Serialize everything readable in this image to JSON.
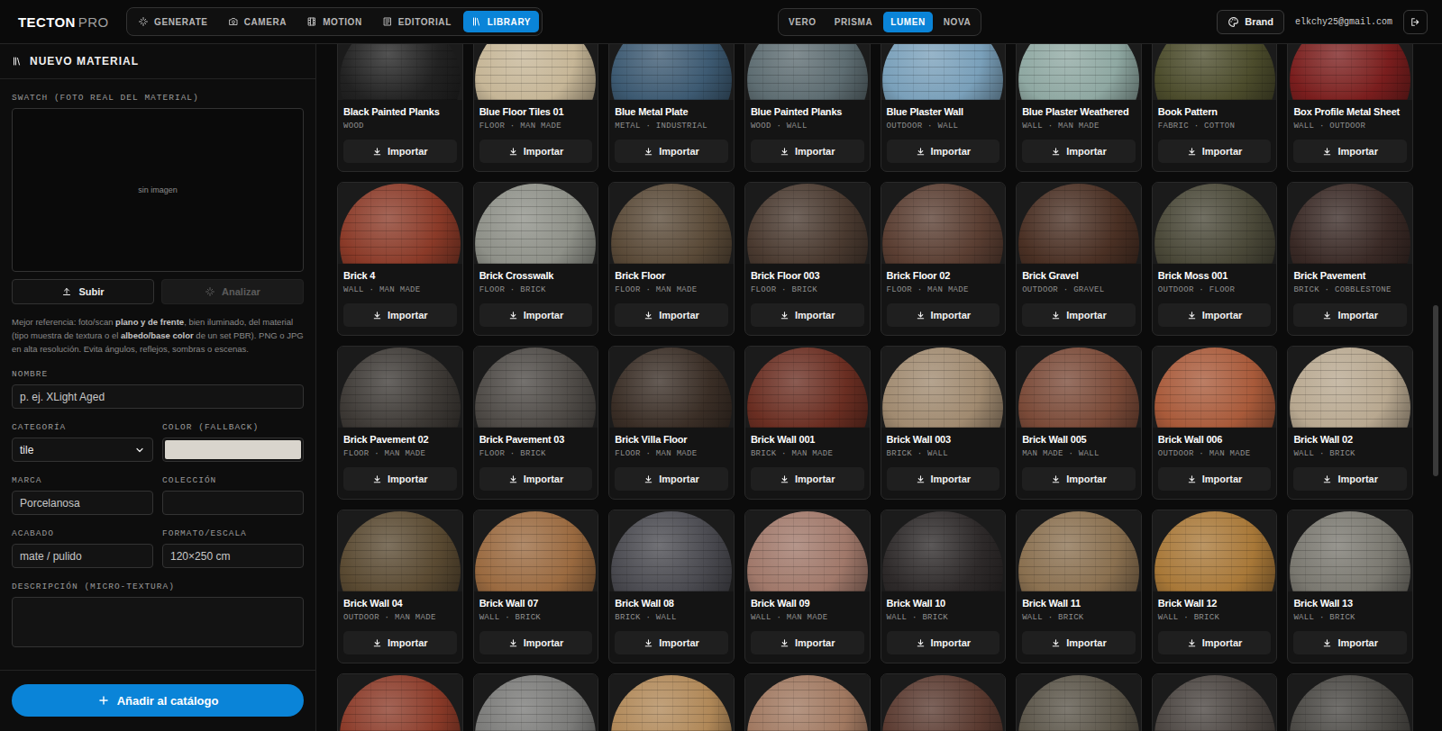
{
  "header": {
    "logo": "TECTON",
    "logo_suffix": "PRO",
    "nav": [
      {
        "label": "GENERATE",
        "selected": false
      },
      {
        "label": "CAMERA",
        "selected": false
      },
      {
        "label": "MOTION",
        "selected": false
      },
      {
        "label": "EDITORIAL",
        "selected": false
      },
      {
        "label": "LIBRARY",
        "selected": true
      }
    ],
    "modes": [
      {
        "label": "VERO",
        "selected": false
      },
      {
        "label": "PRISMA",
        "selected": false
      },
      {
        "label": "LUMEN",
        "selected": true
      },
      {
        "label": "NOVA",
        "selected": false
      }
    ],
    "brand_button": "Brand",
    "email": "elkchy25@gmail.com"
  },
  "sidebar": {
    "title": "NUEVO MATERIAL",
    "swatch_label": "SWATCH (FOTO REAL DEL MATERIAL)",
    "swatch_empty": "sin imagen",
    "upload_button": {
      "label": "Subir",
      "disabled": false
    },
    "analyze_button": {
      "label": "Analizar",
      "disabled": true
    },
    "hint": [
      {
        "text": "Mejor referencia: foto/scan ",
        "bold": false
      },
      {
        "text": "plano y de frente",
        "bold": true
      },
      {
        "text": ", bien iluminado, del material (tipo muestra de textura o el ",
        "bold": false
      },
      {
        "text": "albedo/base color",
        "bold": true
      },
      {
        "text": " de un set PBR). PNG o JPG en alta resolución. Evita ángulos, reflejos, sombras o escenas.",
        "bold": false
      }
    ],
    "field_rows": [
      [
        {
          "label": "NOMBRE",
          "kind": "text",
          "placeholder": "p. ej. XLight Aged"
        }
      ],
      [
        {
          "label": "CATEGORÍA",
          "kind": "select",
          "value": "tile"
        },
        {
          "label": "COLOR (FALLBACK)",
          "kind": "color",
          "value": "#d9d5cd"
        }
      ],
      [
        {
          "label": "MARCA",
          "kind": "text",
          "placeholder": "Porcelanosa"
        },
        {
          "label": "COLECCIÓN",
          "kind": "text",
          "placeholder": ""
        }
      ],
      [
        {
          "label": "ACABADO",
          "kind": "text",
          "placeholder": "mate / pulido"
        },
        {
          "label": "FORMATO/ESCALA",
          "kind": "text",
          "placeholder": "120×250 cm"
        }
      ],
      [
        {
          "label": "DESCRIPCIÓN (MICRO-TEXTURA)",
          "kind": "textarea",
          "placeholder": ""
        }
      ]
    ],
    "submit_button": "Añadir al catálogo"
  },
  "materials": [
    {
      "name": "Black Painted Planks",
      "tags": "WOOD",
      "button": "Importar",
      "color": "#222222"
    },
    {
      "name": "Blue Floor Tiles 01",
      "tags": "FLOOR · MAN MADE",
      "button": "Importar",
      "color": "#c6b697"
    },
    {
      "name": "Blue Metal Plate",
      "tags": "METAL · INDUSTRIAL",
      "button": "Importar",
      "color": "#3d5a72"
    },
    {
      "name": "Blue Painted Planks",
      "tags": "WOOD · WALL",
      "button": "Importar",
      "color": "#5e6d72"
    },
    {
      "name": "Blue Plaster Wall",
      "tags": "OUTDOOR · WALL",
      "button": "Importar",
      "color": "#7aa0ba"
    },
    {
      "name": "Blue Plaster Weathered",
      "tags": "WALL · MAN MADE",
      "button": "Importar",
      "color": "#8fa8a2"
    },
    {
      "name": "Book Pattern",
      "tags": "FABRIC · COTTON",
      "button": "Importar",
      "color": "#4c4c2c"
    },
    {
      "name": "Box Profile Metal Sheet",
      "tags": "WALL · OUTDOOR",
      "button": "Importar",
      "color": "#7a1e1e"
    },
    {
      "name": "Brick 4",
      "tags": "WALL · MAN MADE",
      "button": "Importar",
      "color": "#8a3a28"
    },
    {
      "name": "Brick Crosswalk",
      "tags": "FLOOR · BRICK",
      "button": "Importar",
      "color": "#8e9088"
    },
    {
      "name": "Brick Floor",
      "tags": "FLOOR · MAN MADE",
      "button": "Importar",
      "color": "#5a4a38"
    },
    {
      "name": "Brick Floor 003",
      "tags": "FLOOR · BRICK",
      "button": "Importar",
      "color": "#4a3a30"
    },
    {
      "name": "Brick Floor 02",
      "tags": "FLOOR · MAN MADE",
      "button": "Importar",
      "color": "#5a3e32"
    },
    {
      "name": "Brick Gravel",
      "tags": "OUTDOOR · GRAVEL",
      "button": "Importar",
      "color": "#4a3024"
    },
    {
      "name": "Brick Moss 001",
      "tags": "OUTDOOR · FLOOR",
      "button": "Importar",
      "color": "#4a4838"
    },
    {
      "name": "Brick Pavement",
      "tags": "BRICK · COBBLESTONE",
      "button": "Importar",
      "color": "#3a2a26"
    },
    {
      "name": "Brick Pavement 02",
      "tags": "FLOOR · MAN MADE",
      "button": "Importar",
      "color": "#3e3a36"
    },
    {
      "name": "Brick Pavement 03",
      "tags": "FLOOR · BRICK",
      "button": "Importar",
      "color": "#4e4a46"
    },
    {
      "name": "Brick Villa Floor",
      "tags": "FLOOR · MAN MADE",
      "button": "Importar",
      "color": "#3a2e26"
    },
    {
      "name": "Brick Wall 001",
      "tags": "BRICK · MAN MADE",
      "button": "Importar",
      "color": "#6a2e22"
    },
    {
      "name": "Brick Wall 003",
      "tags": "BRICK · WALL",
      "button": "Importar",
      "color": "#a08a70"
    },
    {
      "name": "Brick Wall 005",
      "tags": "MAN MADE · WALL",
      "button": "Importar",
      "color": "#7a4a38"
    },
    {
      "name": "Brick Wall 006",
      "tags": "OUTDOOR · MAN MADE",
      "button": "Importar",
      "color": "#a85a3a"
    },
    {
      "name": "Brick Wall 02",
      "tags": "WALL · BRICK",
      "button": "Importar",
      "color": "#b8a890"
    },
    {
      "name": "Brick Wall 04",
      "tags": "OUTDOOR · MAN MADE",
      "button": "Importar",
      "color": "#5a4a32"
    },
    {
      "name": "Brick Wall 07",
      "tags": "WALL · BRICK",
      "button": "Importar",
      "color": "#9a6a40"
    },
    {
      "name": "Brick Wall 08",
      "tags": "BRICK · WALL",
      "button": "Importar",
      "color": "#4a4a50"
    },
    {
      "name": "Brick Wall 09",
      "tags": "WALL · MAN MADE",
      "button": "Importar",
      "color": "#a0786a"
    },
    {
      "name": "Brick Wall 10",
      "tags": "WALL · BRICK",
      "button": "Importar",
      "color": "#2e2a2a"
    },
    {
      "name": "Brick Wall 11",
      "tags": "WALL · BRICK",
      "button": "Importar",
      "color": "#8a7050"
    },
    {
      "name": "Brick Wall 12",
      "tags": "WALL · BRICK",
      "button": "Importar",
      "color": "#a87838"
    },
    {
      "name": "Brick Wall 13",
      "tags": "WALL · BRICK",
      "button": "Importar",
      "color": "#7a7870"
    }
  ],
  "materials_cut_off": [
    {
      "color": "#8a3a28"
    },
    {
      "color": "#7a7a78"
    },
    {
      "color": "#b08858"
    },
    {
      "color": "#a07860"
    },
    {
      "color": "#5a3a30"
    },
    {
      "color": "#5a5448"
    },
    {
      "color": "#4a4440"
    },
    {
      "color": "#4a4844"
    }
  ]
}
